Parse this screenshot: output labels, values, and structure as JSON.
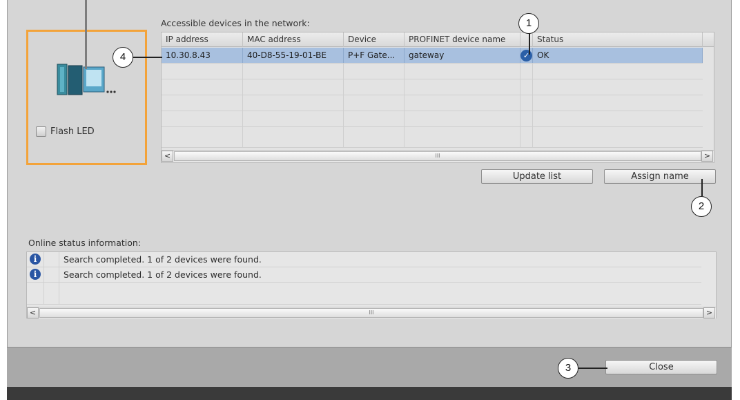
{
  "device_panel": {
    "flash_led_label": "Flash LED"
  },
  "devices": {
    "caption": "Accessible devices in the network:",
    "columns": [
      "IP address",
      "MAC address",
      "Device",
      "PROFINET device name",
      "Status"
    ],
    "rows": [
      {
        "ip": "10.30.8.43",
        "mac": "40-D8-55-19-01-BE",
        "device": "P+F Gate...",
        "name": "gateway",
        "status": "OK",
        "selected": true
      }
    ],
    "scroll_thumb": "III"
  },
  "buttons": {
    "update_list": "Update list",
    "assign_name": "Assign name",
    "close": "Close"
  },
  "online_status": {
    "caption": "Online status information:",
    "messages": [
      "Search completed. 1 of 2 devices were found.",
      "Search completed. 1 of 2 devices were found."
    ],
    "scroll_thumb": "III"
  },
  "callouts": {
    "c1": "1",
    "c2": "2",
    "c3": "3",
    "c4": "4"
  },
  "colors": {
    "highlight": "#f3a33a",
    "selection": "#a8c0df",
    "info": "#2a56a3"
  }
}
